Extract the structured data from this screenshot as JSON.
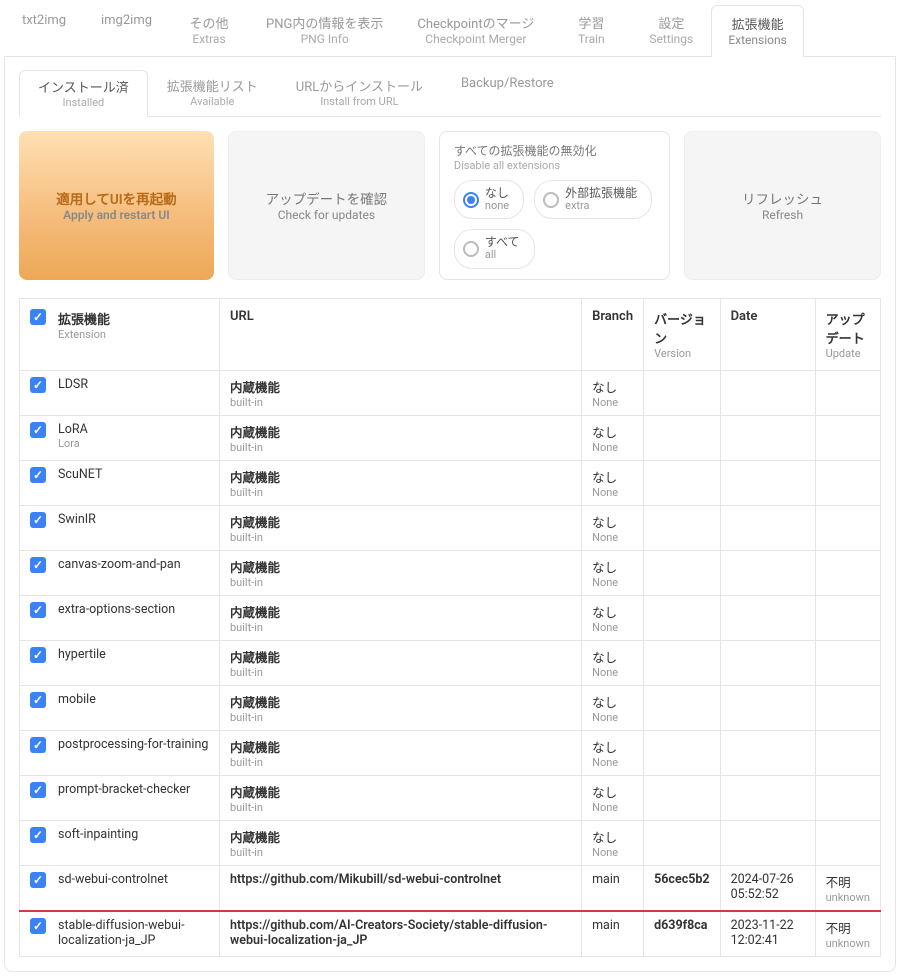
{
  "mainTabs": [
    {
      "jp": "txt2img",
      "en": ""
    },
    {
      "jp": "img2img",
      "en": ""
    },
    {
      "jp": "その他",
      "en": "Extras"
    },
    {
      "jp": "PNG内の情報を表示",
      "en": "PNG Info"
    },
    {
      "jp": "Checkpointのマージ",
      "en": "Checkpoint Merger"
    },
    {
      "jp": "学習",
      "en": "Train"
    },
    {
      "jp": "設定",
      "en": "Settings"
    },
    {
      "jp": "拡張機能",
      "en": "Extensions",
      "active": true
    }
  ],
  "subTabs": [
    {
      "jp": "インストール済",
      "en": "Installed",
      "active": true
    },
    {
      "jp": "拡張機能リスト",
      "en": "Available"
    },
    {
      "jp": "URLからインストール",
      "en": "Install from URL"
    },
    {
      "jp": "Backup/Restore",
      "en": ""
    }
  ],
  "buttons": {
    "apply": {
      "jp": "適用してUIを再起動",
      "en": "Apply and restart UI"
    },
    "check": {
      "jp": "アップデートを確認",
      "en": "Check for updates"
    },
    "refresh": {
      "jp": "リフレッシュ",
      "en": "Refresh"
    }
  },
  "disable": {
    "head_jp": "すべての拡張機能の無効化",
    "head_en": "Disable all extensions",
    "opts": [
      {
        "jp": "なし",
        "en": "none",
        "selected": true
      },
      {
        "jp": "外部拡張機能",
        "en": "extra"
      },
      {
        "jp": "すべて",
        "en": "all"
      }
    ]
  },
  "headers": {
    "ext": {
      "jp": "拡張機能",
      "en": "Extension"
    },
    "url": {
      "jp": "URL",
      "en": ""
    },
    "branch": {
      "jp": "Branch",
      "en": ""
    },
    "version": {
      "jp": "バージョン",
      "en": "Version"
    },
    "date": {
      "jp": "Date",
      "en": ""
    },
    "update": {
      "jp": "アップデート",
      "en": "Update"
    }
  },
  "builtin": {
    "jp": "内蔵機能",
    "en": "built-in"
  },
  "none": {
    "jp": "なし",
    "en": "None"
  },
  "unknown": {
    "jp": "不明",
    "en": "unknown"
  },
  "rows": [
    {
      "name": "LDSR",
      "builtin": true
    },
    {
      "name": "LoRA",
      "name_en": "Lora",
      "builtin": true
    },
    {
      "name": "ScuNET",
      "builtin": true
    },
    {
      "name": "SwinIR",
      "builtin": true
    },
    {
      "name": "canvas-zoom-and-pan",
      "builtin": true
    },
    {
      "name": "extra-options-section",
      "builtin": true
    },
    {
      "name": "hypertile",
      "builtin": true
    },
    {
      "name": "mobile",
      "builtin": true
    },
    {
      "name": "postprocessing-for-training",
      "builtin": true
    },
    {
      "name": "prompt-bracket-checker",
      "builtin": true
    },
    {
      "name": "soft-inpainting",
      "builtin": true
    },
    {
      "name": "sd-webui-controlnet",
      "url": "https://github.com/Mikubill/sd-webui-controlnet",
      "branch": "main",
      "version": "56cec5b2",
      "date": "2024-07-26 05:52:52",
      "unknown": true,
      "highlight": true
    },
    {
      "name": "stable-diffusion-webui-localization-ja_JP",
      "url": "https://github.com/AI-Creators-Society/stable-diffusion-webui-localization-ja_JP",
      "branch": "main",
      "version": "d639f8ca",
      "date": "2023-11-22 12:02:41",
      "unknown": true
    }
  ]
}
